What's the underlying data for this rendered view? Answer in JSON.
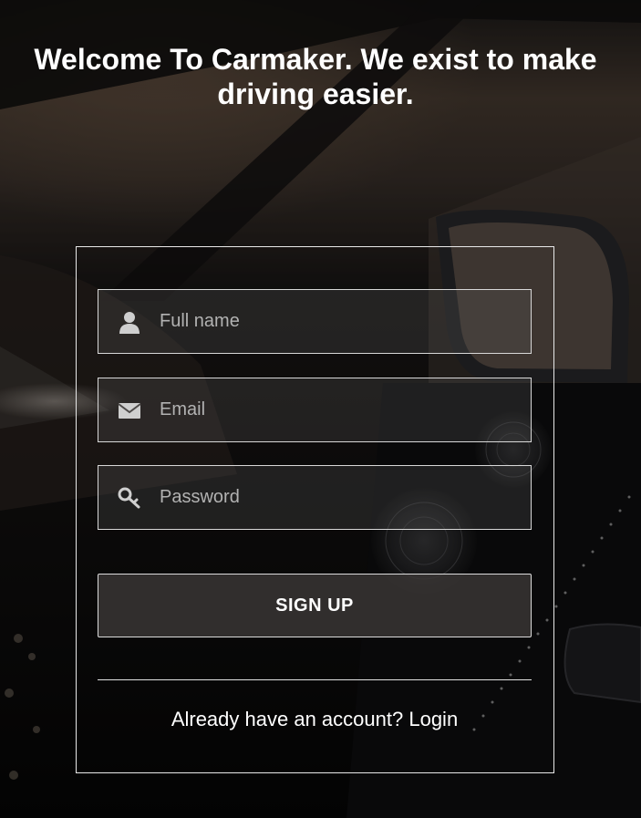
{
  "header": {
    "title": "Welcome To Carmaker. We exist to make driving easier."
  },
  "form": {
    "fields": [
      {
        "placeholder": "Full name",
        "value": "",
        "icon": "user-icon"
      },
      {
        "placeholder": "Email",
        "value": "",
        "icon": "envelope-icon"
      },
      {
        "placeholder": "Password",
        "value": "",
        "icon": "key-icon"
      }
    ],
    "submit_label": "SIGN UP",
    "footer_text": "Already have an account?",
    "login_link": "Login"
  },
  "colors": {
    "text": "#ffffff",
    "placeholder": "#b2b2b2",
    "border": "#e9e9e9",
    "background": "#0b0a0a",
    "button_bg": "#3a3736"
  }
}
